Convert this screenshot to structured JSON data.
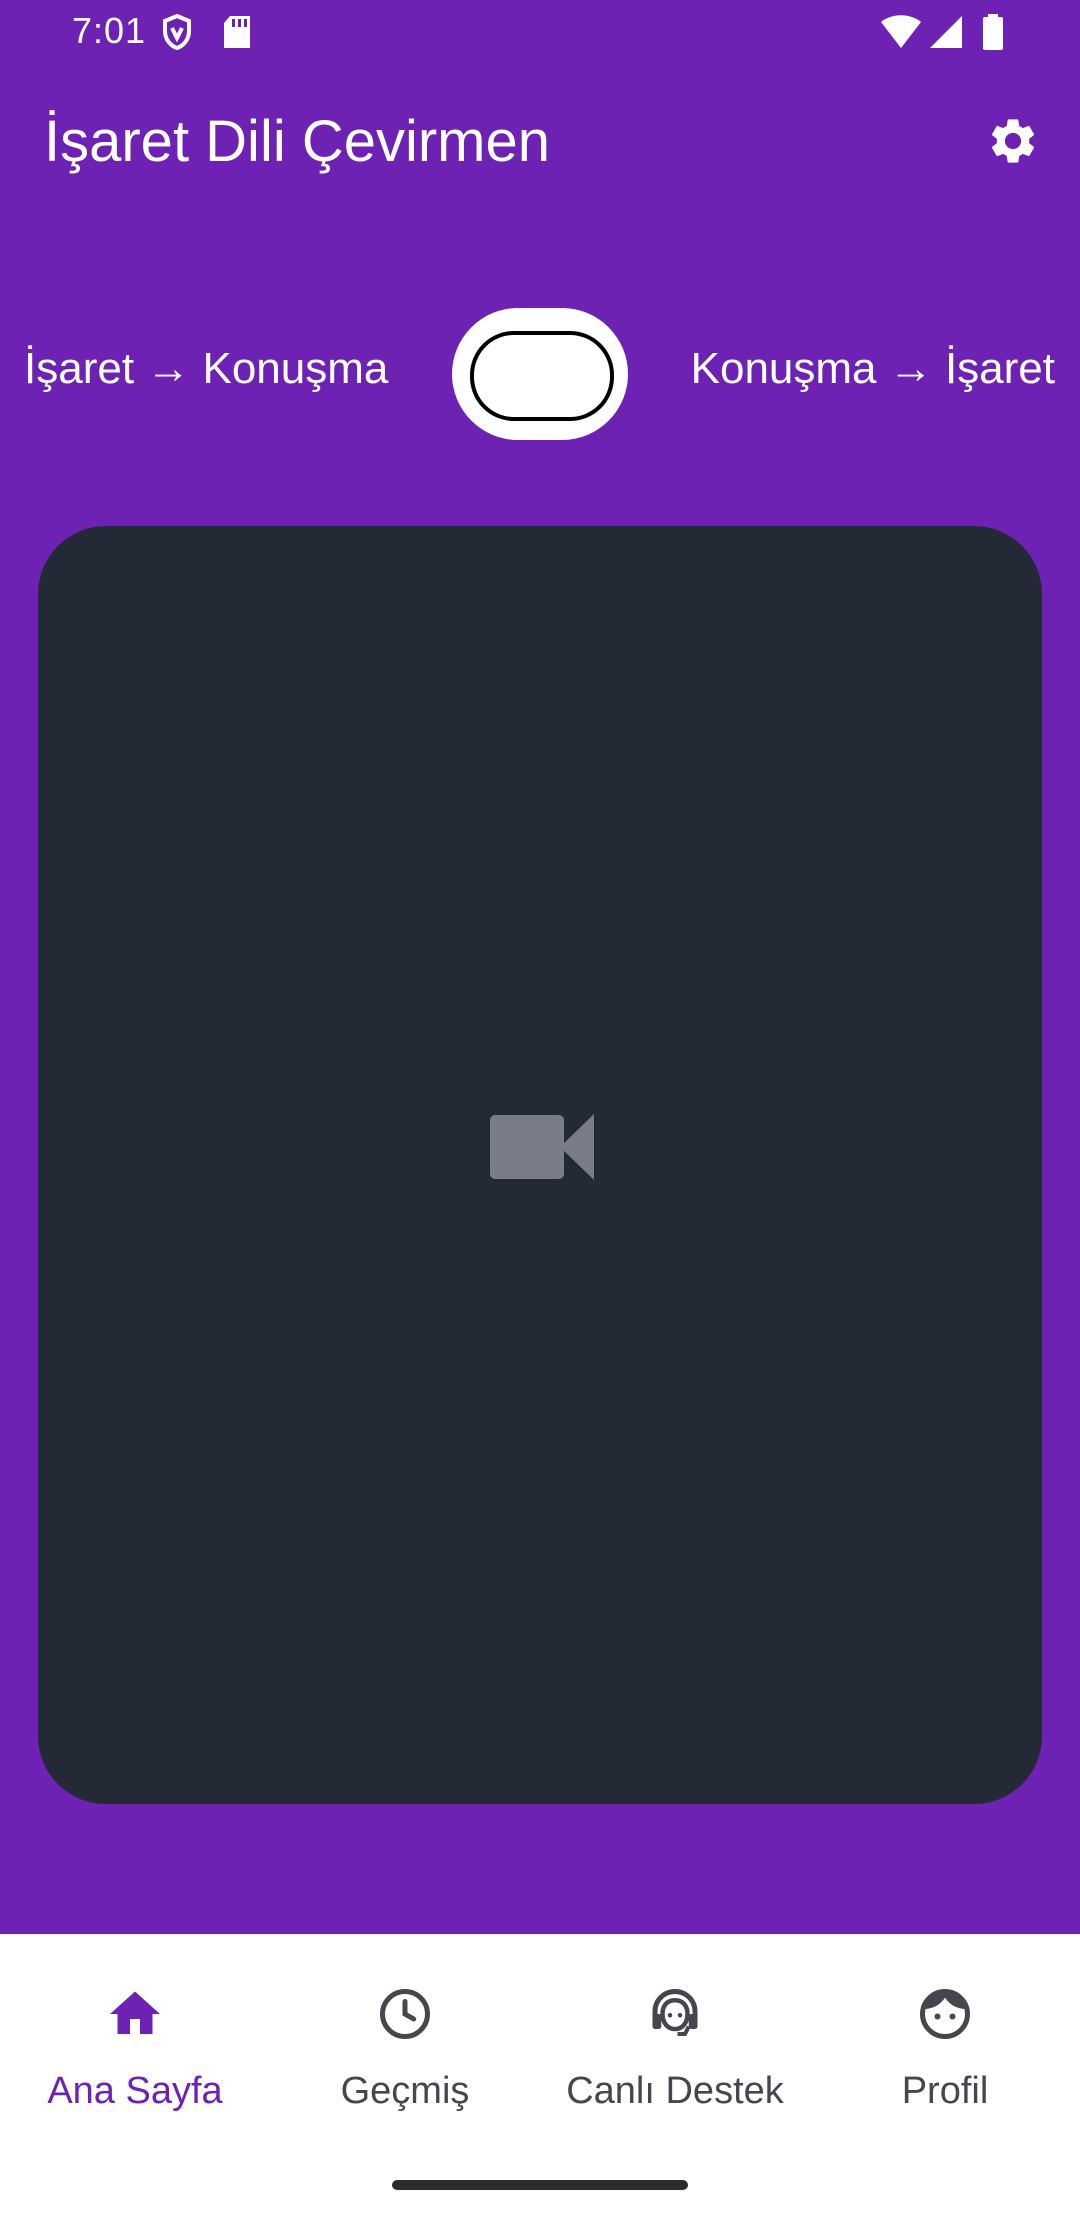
{
  "status_bar": {
    "time": "7:01"
  },
  "app_bar": {
    "title": "İşaret Dili Çevirmen",
    "settings_icon": "gear-icon"
  },
  "mode_toggle": {
    "left_label": "İşaret → Konuşma",
    "right_label": "Konuşma → İşaret"
  },
  "camera": {
    "icon": "video-camera-icon"
  },
  "bottom_nav": {
    "items": [
      {
        "label": "Ana Sayfa",
        "icon": "home-icon",
        "active": true
      },
      {
        "label": "Geçmiş",
        "icon": "clock-icon",
        "active": false
      },
      {
        "label": "Canlı Destek",
        "icon": "headset-agent-icon",
        "active": false
      },
      {
        "label": "Profil",
        "icon": "face-icon",
        "active": false
      }
    ]
  },
  "colors": {
    "primary": "#6d22b3",
    "camera_bg": "#242a35",
    "nav_bg": "#ffffff",
    "nav_inactive": "#49454f"
  }
}
